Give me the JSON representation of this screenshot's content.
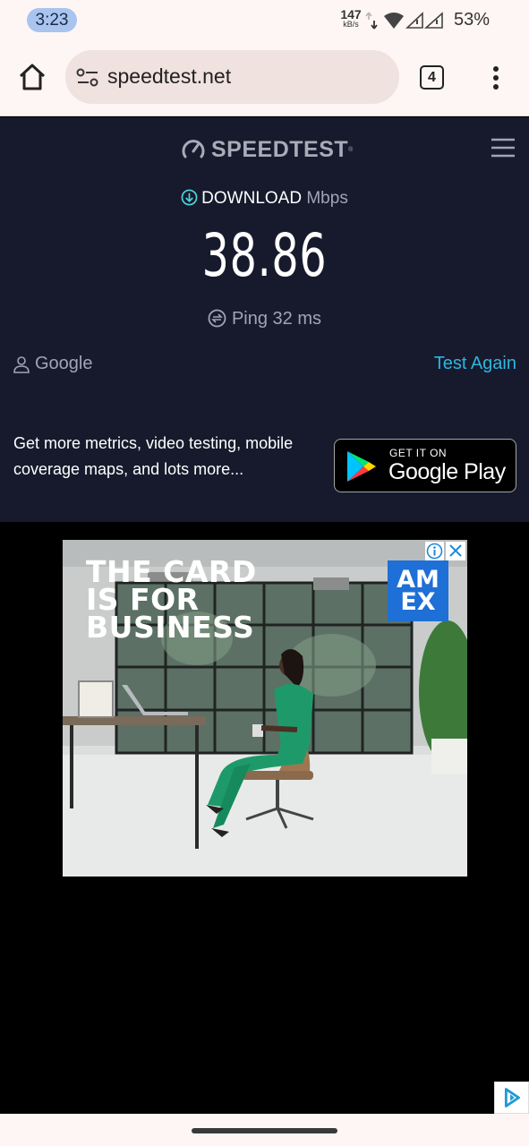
{
  "status_bar": {
    "time": "3:23",
    "net_speed_value": "147",
    "net_speed_unit": "kB/s",
    "battery": "53%"
  },
  "browser": {
    "url": "speedtest.net",
    "tab_count": "4"
  },
  "speedtest": {
    "logo": "SPEEDTEST",
    "trademark": "®",
    "metric_label": "DOWNLOAD",
    "metric_unit": "Mbps",
    "download_value": "38.86",
    "ping_text": "Ping 32 ms",
    "provider": "Google",
    "test_again": "Test Again",
    "promo_text": "Get more metrics, video testing, mobile coverage maps, and lots more...",
    "gplay_small": "GET IT ON",
    "gplay_big": "Google Play"
  },
  "ad": {
    "headline_line1": "THE CARD",
    "headline_line2": "IS FOR",
    "headline_line3": "BUSINESS",
    "brand_line1": "AM",
    "brand_line2": "EX"
  },
  "colors": {
    "speedtest_bg": "#161a2c",
    "accent_link": "#2fb5e0",
    "amex_blue": "#1e6fd6",
    "dress_green": "#1e9a6a"
  },
  "icons": [
    "home-icon",
    "site-settings-icon",
    "tabs-icon",
    "more-vert-icon",
    "speedometer-icon",
    "hamburger-icon",
    "download-icon",
    "ping-icon",
    "user-icon",
    "google-play-icon",
    "ad-info-icon",
    "ad-close-icon",
    "adchoices-icon"
  ]
}
